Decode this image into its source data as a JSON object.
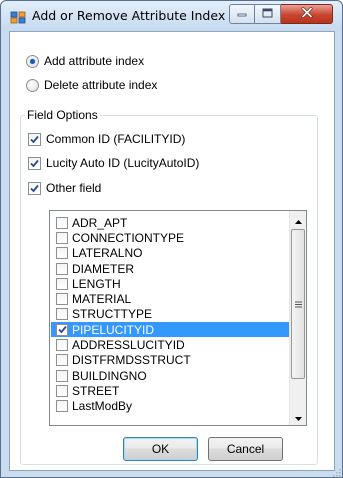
{
  "window": {
    "title": "Add or Remove Attribute Index",
    "icon": "app-window-icon",
    "controls": [
      "minimize-icon",
      "maximize-icon",
      "close-icon"
    ]
  },
  "mode": {
    "options": [
      {
        "label": "Add attribute index",
        "selected": true
      },
      {
        "label": "Delete attribute index",
        "selected": false
      }
    ]
  },
  "field_options": {
    "title": "Field Options",
    "checks": [
      {
        "label": "Common ID (FACILITYID)",
        "checked": true
      },
      {
        "label": "Lucity Auto ID (LucityAutoID)",
        "checked": true
      },
      {
        "label": "Other field",
        "checked": true
      }
    ]
  },
  "fields": {
    "items": [
      {
        "label": "ADR_APT",
        "checked": false,
        "selected": false
      },
      {
        "label": "CONNECTIONTYPE",
        "checked": false,
        "selected": false
      },
      {
        "label": "LATERALNO",
        "checked": false,
        "selected": false
      },
      {
        "label": "DIAMETER",
        "checked": false,
        "selected": false
      },
      {
        "label": "LENGTH",
        "checked": false,
        "selected": false
      },
      {
        "label": "MATERIAL",
        "checked": false,
        "selected": false
      },
      {
        "label": "STRUCTTYPE",
        "checked": false,
        "selected": false
      },
      {
        "label": "PIPELUCITYID",
        "checked": true,
        "selected": true
      },
      {
        "label": "ADDRESSLUCITYID",
        "checked": false,
        "selected": false
      },
      {
        "label": "DISTFRMDSSTRUCT",
        "checked": false,
        "selected": false
      },
      {
        "label": "BUILDINGNO",
        "checked": false,
        "selected": false
      },
      {
        "label": "STREET",
        "checked": false,
        "selected": false
      },
      {
        "label": "LastModBy",
        "checked": false,
        "selected": false
      }
    ]
  },
  "buttons": {
    "ok": "OK",
    "cancel": "Cancel"
  },
  "colors": {
    "selection": "#3399ff",
    "radio_dot": "#1d5caa",
    "check_mark": "#2a4a8a"
  }
}
